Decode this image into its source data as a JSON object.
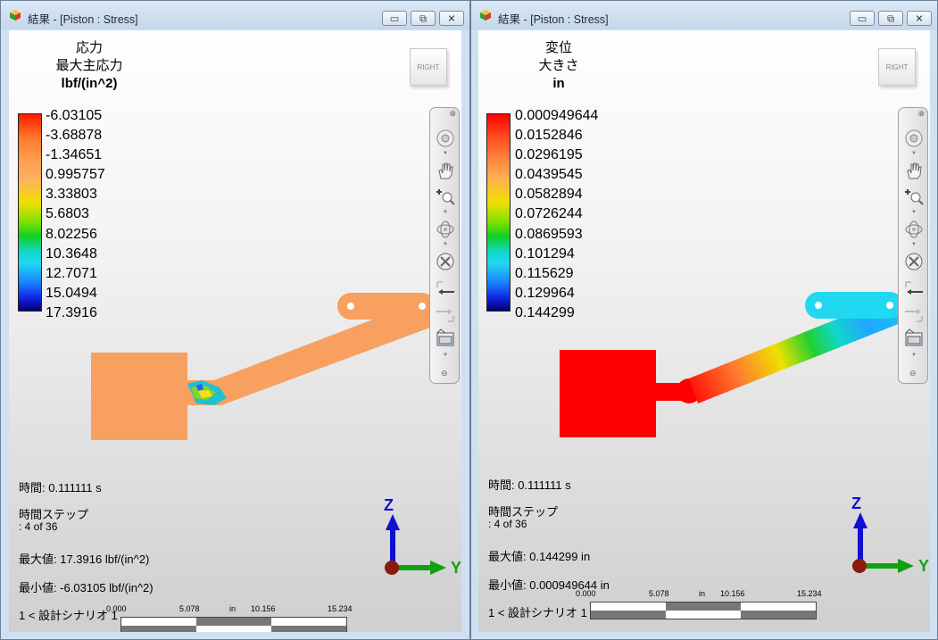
{
  "windows": [
    {
      "title": "結果 - [Piston : Stress]",
      "legend": {
        "line1": "応力",
        "line2": "最大主応力",
        "unit": "lbf/(in^2)"
      },
      "ticks": [
        "-6.03105",
        "-3.68878",
        "-1.34651",
        "0.995757",
        "3.33803",
        "5.6803",
        "8.02256",
        "10.3648",
        "12.7071",
        "15.0494",
        "17.3916"
      ],
      "viewcube_label": "RIGHT",
      "info": {
        "time": "時間: 0.111111 s",
        "timestep_label": "時間ステップ",
        "timestep_value": ":  4 of 36",
        "max": "最大値: 17.3916 lbf/(in^2)",
        "min": "最小値: -6.03105 lbf/(in^2)"
      },
      "scenario": "1 < 設計シナリオ 1",
      "scale_labels": {
        "a": "0.000",
        "b": "5.078",
        "unit": "in",
        "c": "10.156",
        "d": "15.234"
      },
      "triad": {
        "z": "Z",
        "y": "Y"
      }
    },
    {
      "title": "結果 - [Piston : Stress]",
      "legend": {
        "line1": "変位",
        "line2": "大きさ",
        "unit": "in"
      },
      "ticks": [
        "0.000949644",
        "0.0152846",
        "0.0296195",
        "0.0439545",
        "0.0582894",
        "0.0726244",
        "0.0869593",
        "0.101294",
        "0.115629",
        "0.129964",
        "0.144299"
      ],
      "viewcube_label": "RIGHT",
      "info": {
        "time": "時間: 0.111111 s",
        "timestep_label": "時間ステップ",
        "timestep_value": ":  4 of 36",
        "max": "最大値: 0.144299 in",
        "min": "最小値: 0.000949644 in"
      },
      "scenario": "1 < 設計シナリオ 1",
      "scale_labels": {
        "a": "0.000",
        "b": "5.078",
        "unit": "in",
        "c": "10.156",
        "d": "15.234"
      },
      "triad": {
        "z": "Z",
        "y": "Y"
      }
    }
  ],
  "window_buttons": {
    "minimize": "▭",
    "restore": "⧉",
    "close": "✕"
  },
  "colors": {
    "stress_model": "#f7a060",
    "disp_body": "#ff0000",
    "axis_z": "#1010d0",
    "axis_y": "#10a010",
    "axis_x": "#8b1a0a"
  }
}
